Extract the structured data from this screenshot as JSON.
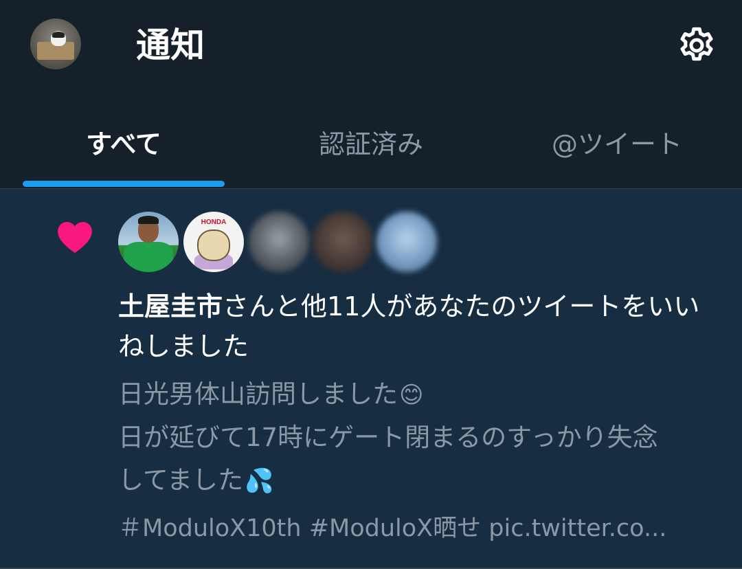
{
  "header": {
    "title": "通知",
    "settings_icon": "gear-icon"
  },
  "tabs": [
    {
      "label": "すべて",
      "active": true
    },
    {
      "label": "認証済み",
      "active": false
    },
    {
      "label": "@ツイート",
      "active": false
    }
  ],
  "colors": {
    "background": "#15202b",
    "notification_bg": "#172d42",
    "accent": "#1d9bf0",
    "like": "#f91880",
    "secondary_text": "#8b98a5"
  },
  "notification": {
    "type_icon": "heart-icon",
    "brand_text": "HONDA",
    "liker_name": "土屋圭市",
    "summary_rest": "さんと他11人があなたのツイートをいいねしました",
    "tweet_lines": [
      "日光男体山訪問しました",
      "日が延びて17時にゲート閉まるのすっかり失念",
      "してました"
    ],
    "emojis": [
      "😊",
      "💦"
    ],
    "hashtags": "＃ModuloX10th #ModuloX晒せ pic.twitter.co..."
  }
}
